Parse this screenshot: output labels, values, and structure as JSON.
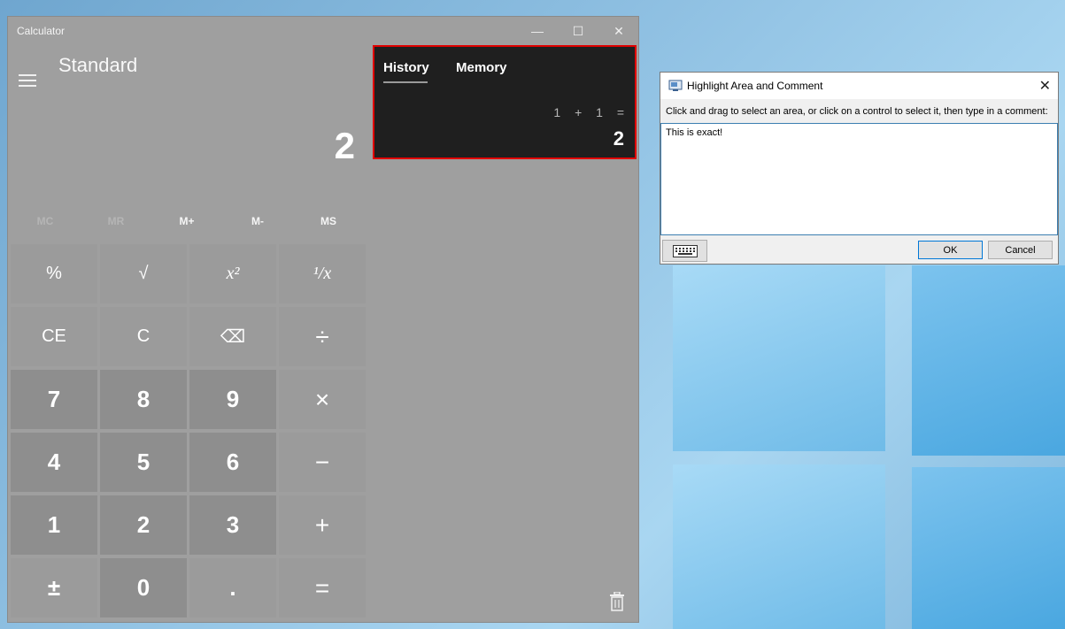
{
  "calculator": {
    "title": "Calculator",
    "window_controls": {
      "minimize": "—",
      "maximize": "☐",
      "close": "✕"
    },
    "mode": "Standard",
    "display": "2",
    "memory_buttons": [
      {
        "label": "MC",
        "enabled": false
      },
      {
        "label": "MR",
        "enabled": false
      },
      {
        "label": "M+",
        "enabled": true
      },
      {
        "label": "M-",
        "enabled": true
      },
      {
        "label": "MS",
        "enabled": true
      }
    ],
    "keys": [
      [
        "%",
        "√",
        "x²",
        "¹/x"
      ],
      [
        "CE",
        "C",
        "⌫",
        "÷"
      ],
      [
        "7",
        "8",
        "9",
        "×"
      ],
      [
        "4",
        "5",
        "6",
        "−"
      ],
      [
        "1",
        "2",
        "3",
        "+"
      ],
      [
        "±",
        "0",
        ".",
        "="
      ]
    ],
    "history_panel": {
      "tabs": [
        "History",
        "Memory"
      ],
      "active_tab": "History",
      "expression": "1 + 1 =",
      "result": "2"
    }
  },
  "dialog": {
    "title": "Highlight Area and Comment",
    "instruction": "Click and drag to select an area, or click on a control to select it, then type in a comment:",
    "comment": "This is exact!",
    "ok_label": "OK",
    "cancel_label": "Cancel",
    "close_glyph": "✕"
  }
}
